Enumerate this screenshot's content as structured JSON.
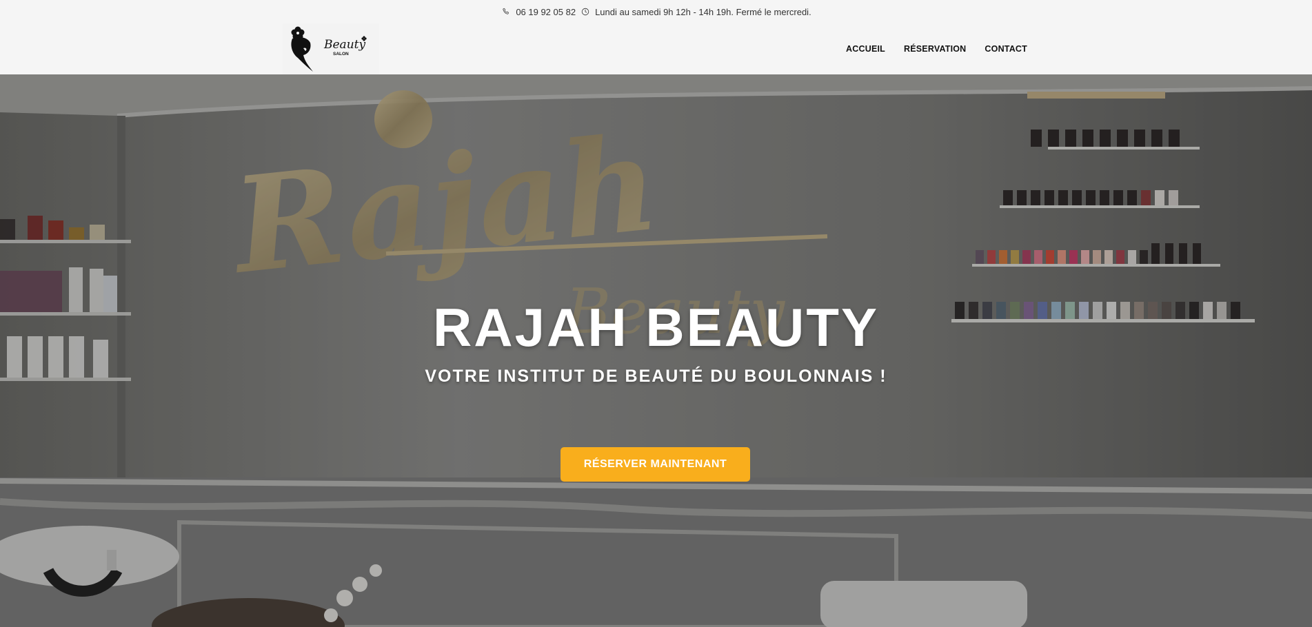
{
  "topbar": {
    "phone_icon": "phone-icon",
    "phone": "06 19 92 05 82",
    "clock_icon": "clock-icon",
    "hours": "Lundi au samedi 9h 12h - 14h 19h. Fermé le mercredi."
  },
  "header": {
    "logo": {
      "wordmark": "Beauty",
      "sub": "SALON"
    },
    "nav": [
      {
        "label": "ACCUEIL"
      },
      {
        "label": "RÉSERVATION"
      },
      {
        "label": "CONTACT"
      }
    ]
  },
  "hero": {
    "title": "RAJAH BEAUTY",
    "subtitle": "VOTRE INSTITUT DE BEAUTÉ DU BOULONNAIS !",
    "cta_label": "RÉSERVER MAINTENANT",
    "wall_sign": "Rajah",
    "wall_sign_sub": "Beauty"
  },
  "colors": {
    "accent": "#f9ae1c",
    "header_bg": "#f5f5f5",
    "text_dark": "#111111"
  }
}
